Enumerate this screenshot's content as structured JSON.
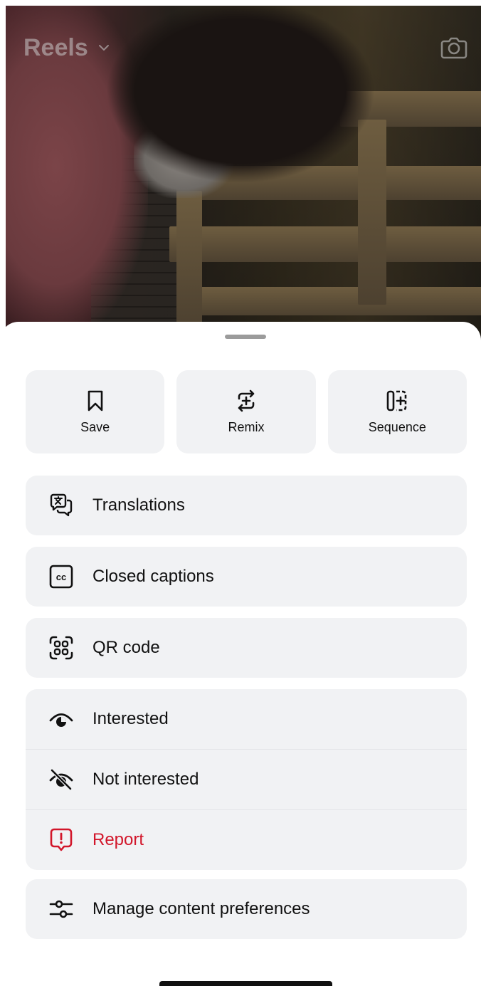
{
  "header": {
    "title": "Reels"
  },
  "quick_actions": [
    {
      "label": "Save",
      "icon": "bookmark-icon"
    },
    {
      "label": "Remix",
      "icon": "remix-icon"
    },
    {
      "label": "Sequence",
      "icon": "sequence-icon"
    }
  ],
  "menu": {
    "translations": "Translations",
    "closed_captions": "Closed captions",
    "qr_code": "QR code",
    "interested": "Interested",
    "not_interested": "Not interested",
    "report": "Report",
    "manage_preferences": "Manage content preferences"
  },
  "colors": {
    "report_red": "#d2162a",
    "sheet_card": "#f1f2f4"
  }
}
